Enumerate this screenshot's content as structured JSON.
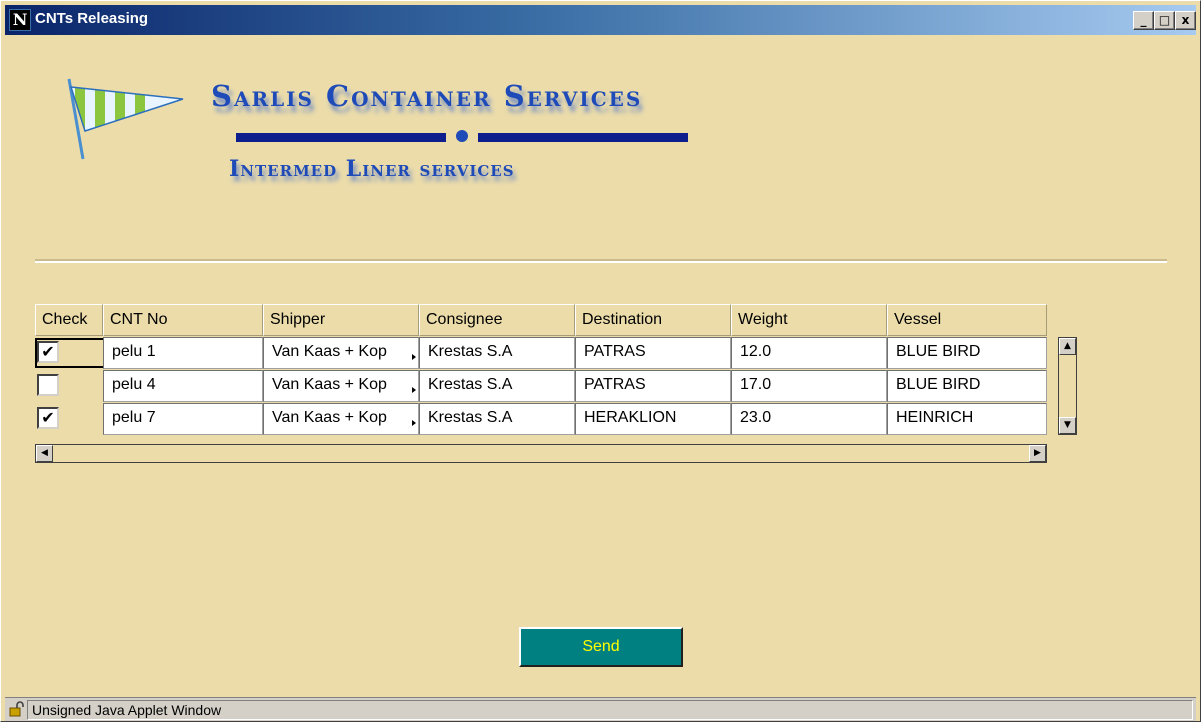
{
  "window": {
    "title": "CNTs Releasing",
    "app_icon": "N",
    "minimize_glyph": "_",
    "maximize_glyph": "□",
    "close_glyph": "x"
  },
  "brand": {
    "line1": "Sarlis Container Services",
    "line2": "Intermed Liner services",
    "logo_icon": "striped-pennant-flag-icon",
    "colors": {
      "text": "#1f4bb8",
      "bar": "#0e1e8c",
      "flag_green": "#8cc63f"
    }
  },
  "table": {
    "columns": [
      "Check",
      "CNT No",
      "Shipper",
      "Consignee",
      "Destination",
      "Weight",
      "Vessel"
    ],
    "rows": [
      {
        "checked": true,
        "check_mark": "✔",
        "cnt_no": "pelu 1",
        "shipper": "Van Kaas + Kop",
        "consignee": "Krestas S.A",
        "destination": "PATRAS",
        "weight": "12.0",
        "vessel": "BLUE BIRD"
      },
      {
        "checked": false,
        "check_mark": "",
        "cnt_no": "pelu 4",
        "shipper": "Van Kaas + Kop",
        "consignee": "Krestas S.A",
        "destination": "PATRAS",
        "weight": "17.0",
        "vessel": "BLUE BIRD"
      },
      {
        "checked": true,
        "check_mark": "✔",
        "cnt_no": "pelu 7",
        "shipper": "Van Kaas + Kop",
        "consignee": "Krestas S.A",
        "destination": "HERAKLION",
        "weight": "23.0",
        "vessel": "HEINRICH"
      }
    ]
  },
  "scrollbars": {
    "up_glyph": "▲",
    "down_glyph": "▼",
    "left_glyph": "◀",
    "right_glyph": "▶"
  },
  "actions": {
    "send_label": "Send"
  },
  "status": {
    "text": "Unsigned Java Applet Window",
    "icon": "unlocked-padlock-icon"
  },
  "colors": {
    "background": "#ebdcaa",
    "send_bg": "#008080",
    "send_text": "#ffff00"
  }
}
